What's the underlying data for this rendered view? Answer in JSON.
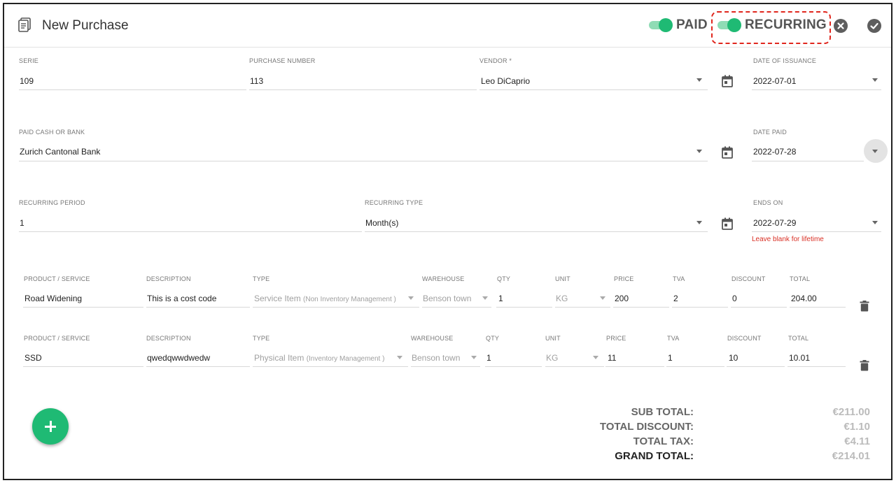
{
  "header": {
    "title": "New Purchase",
    "paid_label": "PAID",
    "recurring_label": "RECURRING",
    "paid_on": true,
    "recurring_on": true,
    "accent_color": "#1fba74"
  },
  "form": {
    "serie": {
      "label": "SERIE",
      "value": "109"
    },
    "purchase_number": {
      "label": "PURCHASE NUMBER",
      "value": "113"
    },
    "vendor": {
      "label": "VENDOR *",
      "value": "Leo DiCaprio"
    },
    "date_of_issuance": {
      "label": "DATE OF ISSUANCE",
      "value": "2022-07-01"
    },
    "paid_cash_or_bank": {
      "label": "PAID CASH OR BANK",
      "value": "Zurich Cantonal Bank"
    },
    "date_paid": {
      "label": "DATE PAID",
      "value": "2022-07-28"
    },
    "recurring_period": {
      "label": "RECURRING PERIOD",
      "value": "1"
    },
    "recurring_type": {
      "label": "RECURRING TYPE",
      "value": "Month(s)"
    },
    "ends_on": {
      "label": "ENDS ON",
      "value": "2022-07-29",
      "hint": "Leave blank for lifetime"
    }
  },
  "columns": {
    "product": "PRODUCT / SERVICE",
    "description": "DESCRIPTION",
    "type": "TYPE",
    "warehouse": "WAREHOUSE",
    "qty": "QTY",
    "unit": "UNIT",
    "price": "PRICE",
    "tva": "TVA",
    "discount": "DISCOUNT",
    "total": "TOTAL"
  },
  "items": [
    {
      "product": "Road Widening",
      "description": "This is a cost code",
      "type_main": "Service Item",
      "type_note": "(Non Inventory Management )",
      "warehouse": "Benson town",
      "qty": "1",
      "unit": "KG",
      "price": "200",
      "tva": "2",
      "discount": "0",
      "total": "204.00"
    },
    {
      "product": "SSD",
      "description": "qwedqwwdwedw",
      "type_main": "Physical Item",
      "type_note": "(Inventory Management )",
      "warehouse": "Benson town",
      "qty": "1",
      "unit": "KG",
      "price": "11",
      "tva": "1",
      "discount": "10",
      "total": "10.01"
    }
  ],
  "totals": {
    "sub_total_label": "SUB TOTAL:",
    "sub_total": "€211.00",
    "total_discount_label": "TOTAL DISCOUNT:",
    "total_discount": "€1.10",
    "total_tax_label": "TOTAL TAX:",
    "total_tax": "€4.11",
    "grand_total_label": "GRAND TOTAL:",
    "grand_total": "€214.01"
  },
  "icons": {
    "document": "document-icon",
    "calendar": "calendar-icon",
    "close": "close-icon",
    "confirm": "check-icon",
    "delete": "trash-icon",
    "add": "plus-icon"
  }
}
